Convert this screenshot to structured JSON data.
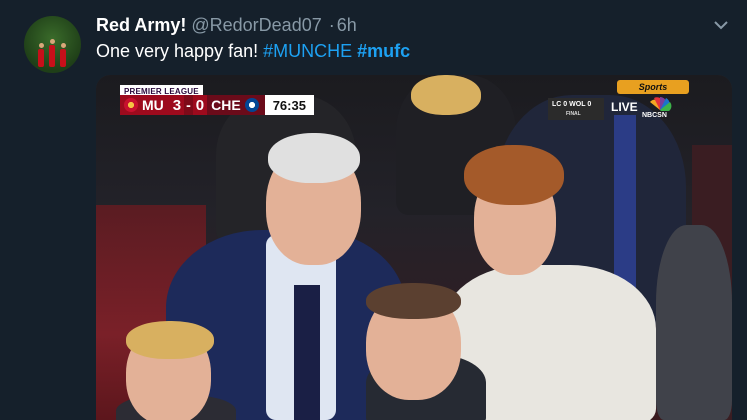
{
  "tweet": {
    "display_name": "Red Army!",
    "handle": "@RedorDead07",
    "separator": "·",
    "time": "6h",
    "text_plain": "One very happy fan! ",
    "hashtag_1": "#MUNCHE",
    "hashtag_2": "#mufc"
  },
  "icons": {
    "avatar": "avatar",
    "menu": "chevron-down-icon"
  },
  "media": {
    "broadcast": {
      "competition": "PREMIER LEAGUE",
      "home_team": "MU",
      "home_score": "3",
      "dash": "-",
      "away_score": "0",
      "away_team": "CHE",
      "clock": "76:35",
      "other_game_home": "LC",
      "other_game_home_score": "0",
      "other_game_away": "WOL",
      "other_game_away_score": "0",
      "other_game_status": "FINAL",
      "live_label": "LIVE",
      "network_sports": "Sports",
      "network": "NBCSN"
    }
  },
  "colors": {
    "background": "#15202b",
    "link": "#1da1f2",
    "muted": "#8899a6",
    "home_team_red": "#9d0a1d"
  }
}
